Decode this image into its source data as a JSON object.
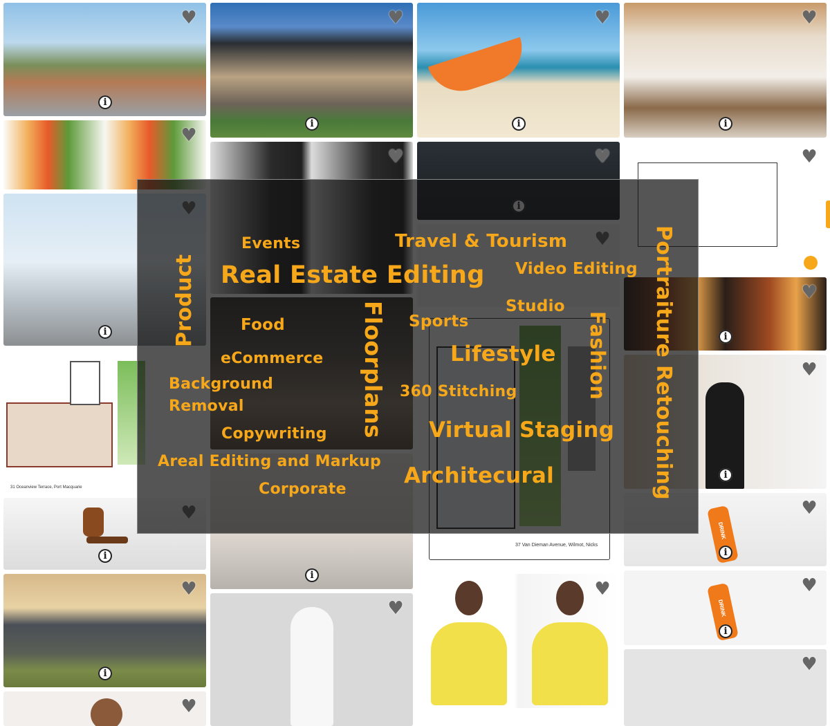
{
  "gallery": {
    "heart_icon": "heart-icon",
    "info_icon": "info-icon",
    "info_glyph": "i",
    "heart_glyph": "♥",
    "floorplan1_caption": "31 Oceanview Terrace, Port Macquarie",
    "floorplan2_caption": "37 Van Dieman Avenue, Wilmot, Nicks",
    "bottle_label": "DRINK"
  },
  "overlay": {
    "words": {
      "product": "Product",
      "events": "Events",
      "travel": "Travel & Tourism",
      "real_estate": "Real Estate Editing",
      "video": "Video Editing",
      "portraiture": "Portraiture Retouching",
      "studio": "Studio",
      "food": "Food",
      "floorplans": "Floorplans",
      "sports": "Sports",
      "fashion": "Fashion",
      "lifestyle": "Lifestyle",
      "ecommerce": "eCommerce",
      "background1": "Background",
      "background2": "Removal",
      "stitching": "360 Stitching",
      "copywriting": "Copywriting",
      "virtual_staging": "Virtual Staging",
      "areal": "Areal Editing and Markup",
      "architectural": "Architecural",
      "corporate": "Corporate"
    }
  },
  "colors": {
    "accent": "#f6a81a",
    "overlay_bg": "#1a1a1a"
  }
}
